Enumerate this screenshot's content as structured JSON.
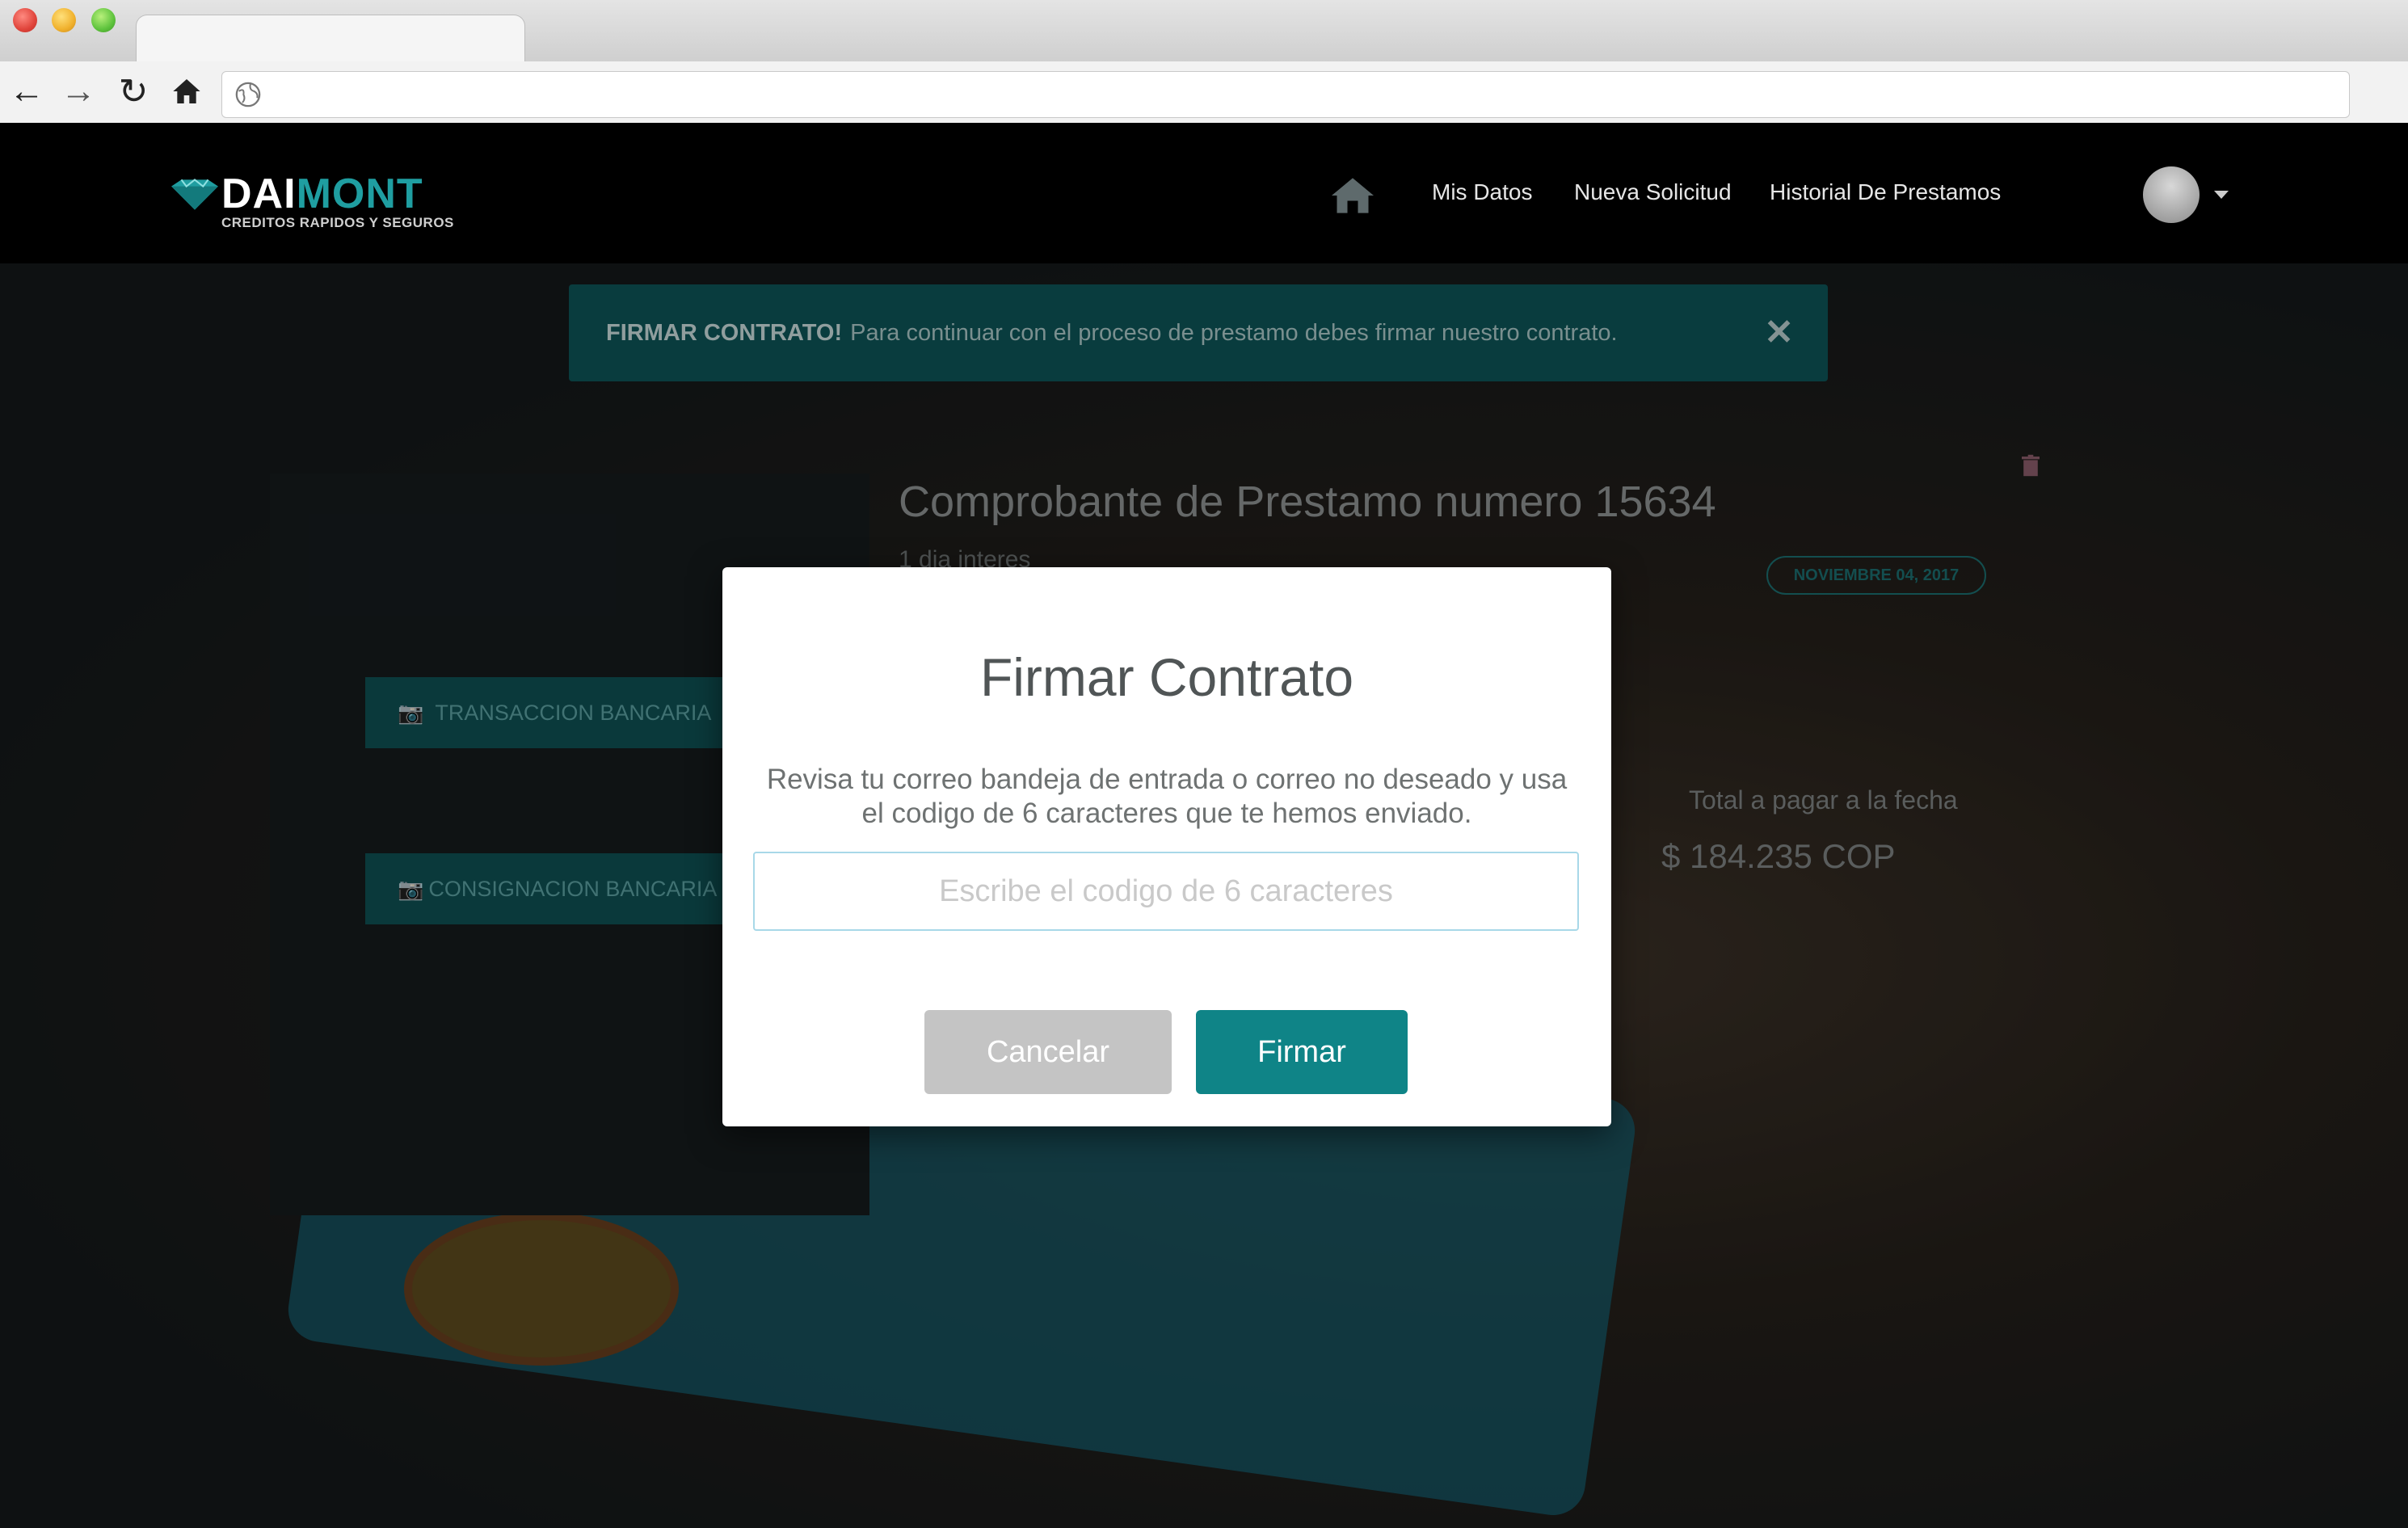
{
  "header": {
    "logo_main": "DAI",
    "logo_accent": "MONT",
    "logo_tagline": "CREDITOS RAPIDOS Y SEGUROS",
    "nav": [
      {
        "label": "Mis Datos"
      },
      {
        "label": "Nueva Solicitud"
      },
      {
        "label": "Historial De Prestamos"
      }
    ]
  },
  "alert": {
    "strong": "FIRMAR CONTRATO!",
    "message": "Para continuar con el proceso de prestamo debes firmar nuestro contrato.",
    "close": "✕"
  },
  "receipt": {
    "title": "Comprobante de Prestamo numero 15634",
    "subtitle": "1 dia interes",
    "date_badge": "NOVIEMBRE 04, 2017",
    "total_label": "Total a pagar a la fecha",
    "total_amount": "$  184.235 COP"
  },
  "side_panel": {
    "buttons": [
      {
        "label": "TRANSACCION BANCARIA"
      },
      {
        "label": "CONSIGNACION BANCARIA"
      }
    ]
  },
  "modal": {
    "title": "Firmar Contrato",
    "text": "Revisa tu correo bandeja de entrada o correo no deseado y usa el codigo de 6 caracteres que te hemos enviado.",
    "input_placeholder": "Escribe el codigo de 6 caracteres",
    "cancel_label": "Cancelar",
    "sign_label": "Firmar"
  },
  "colors": {
    "accent": "#0f8487",
    "header_bg": "#000000"
  }
}
